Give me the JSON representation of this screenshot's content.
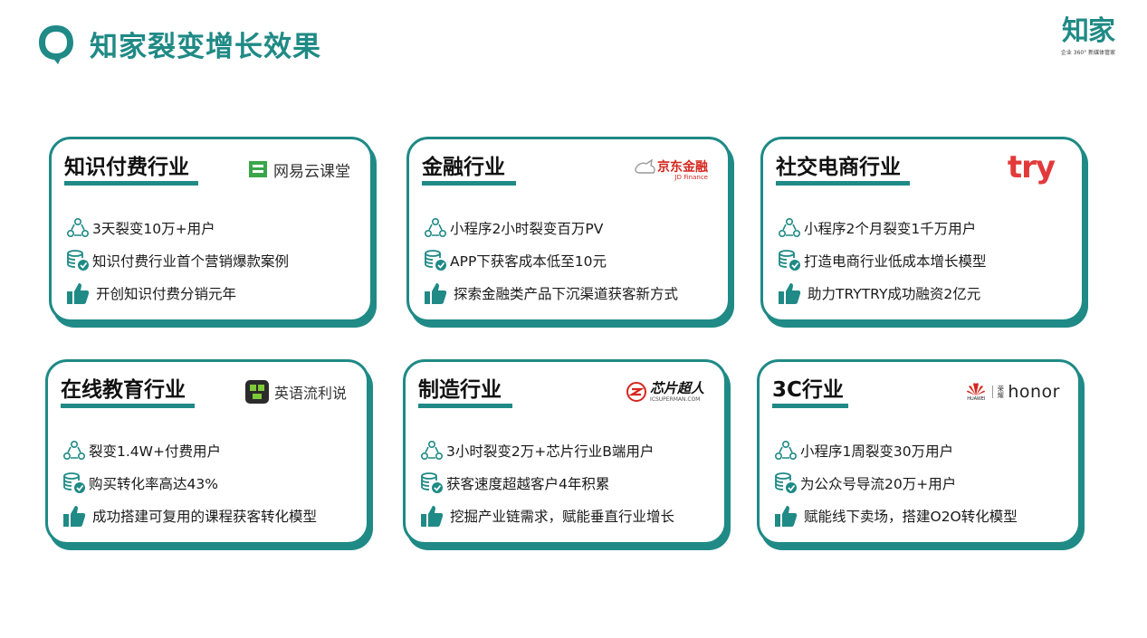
{
  "page": {
    "title": "知家裂变增长效果"
  },
  "brand": {
    "name": "知家",
    "tagline": "企业 360° 新媒体管家"
  },
  "icons": {
    "people": "people-network-icon",
    "coins": "coin-check-icon",
    "thumb": "thumbs-up-icon"
  },
  "colors": {
    "accent": "#1f8a86"
  },
  "cards": [
    {
      "title": "知识付费行业",
      "logo_text": "网易云课堂",
      "items": [
        "3天裂变10万+用户",
        "知识付费行业首个营销爆款案例",
        "开创知识付费分销元年"
      ]
    },
    {
      "title": "金融行业",
      "logo_text": "京东金融",
      "logo_sub": "JD Finance",
      "items": [
        "小程序2小时裂变百万PV",
        "APP下获客成本低至10元",
        "探索金融类产品下沉渠道获客新方式"
      ]
    },
    {
      "title": "社交电商行业",
      "logo_text": "try",
      "items": [
        "小程序2个月裂变1千万用户",
        "打造电商行业低成本增长模型",
        "助力TRYTRY成功融资2亿元"
      ]
    },
    {
      "title": "在线教育行业",
      "logo_text": "英语流利说",
      "items": [
        "裂变1.4W+付费用户",
        "购买转化率高达43%",
        "成功搭建可复用的课程获客转化模型"
      ]
    },
    {
      "title": "制造行业",
      "logo_text": "芯片超人",
      "logo_sub": "ICSUPERMAN.COM",
      "items": [
        "3小时裂变2万+芯片行业B端用户",
        "获客速度超越客户4年积累",
        "挖掘产业链需求，赋能垂直行业增长"
      ]
    },
    {
      "title": "3C行业",
      "logo_text": "honor",
      "logo_sub": "HUAWEI",
      "logo_cn": "荣耀",
      "items": [
        "小程序1周裂变30万用户",
        "为公众号导流20万+用户",
        "赋能线下卖场，搭建O2O转化模型"
      ]
    }
  ]
}
